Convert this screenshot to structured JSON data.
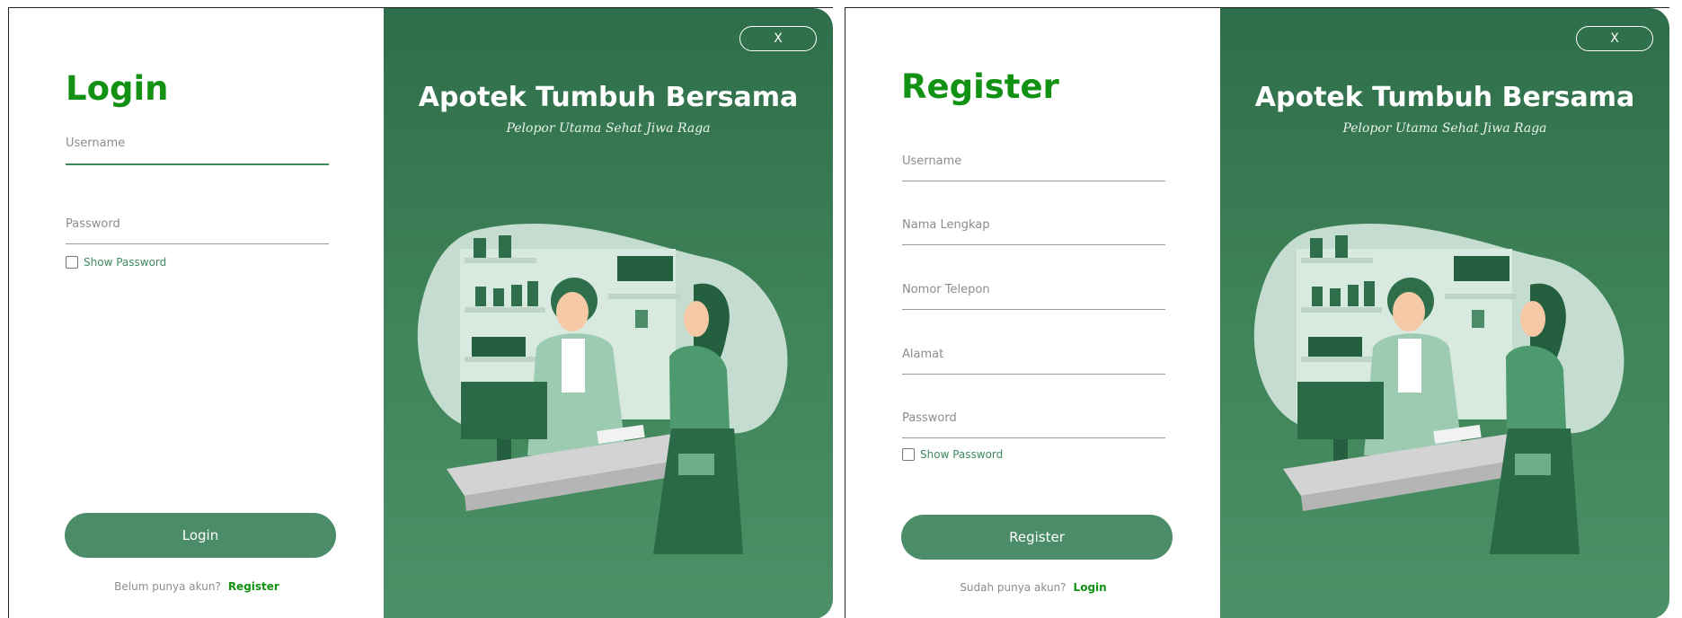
{
  "login": {
    "title": "Login",
    "fields": {
      "username_label": "Username",
      "password_label": "Password"
    },
    "show_password_label": "Show Password",
    "submit_label": "Login",
    "footer_prompt": "Belum punya akun?",
    "footer_link": "Register"
  },
  "register": {
    "title": "Register",
    "fields": {
      "username_label": "Username",
      "fullname_label": "Nama Lengkap",
      "phone_label": "Nomor Telepon",
      "address_label": "Alamat",
      "password_label": "Password"
    },
    "show_password_label": "Show Password",
    "submit_label": "Register",
    "footer_prompt": "Sudah punya akun?",
    "footer_link": "Login"
  },
  "brand": {
    "title": "Apotek Tumbuh Bersama",
    "tagline": "Pelopor Utama Sehat Jiwa Raga",
    "close_label": "X"
  },
  "colors": {
    "accent_green": "#129112",
    "button_green": "#4a8d68",
    "panel_green_top": "#2e6e4a",
    "panel_green_bottom": "#4b9066"
  }
}
